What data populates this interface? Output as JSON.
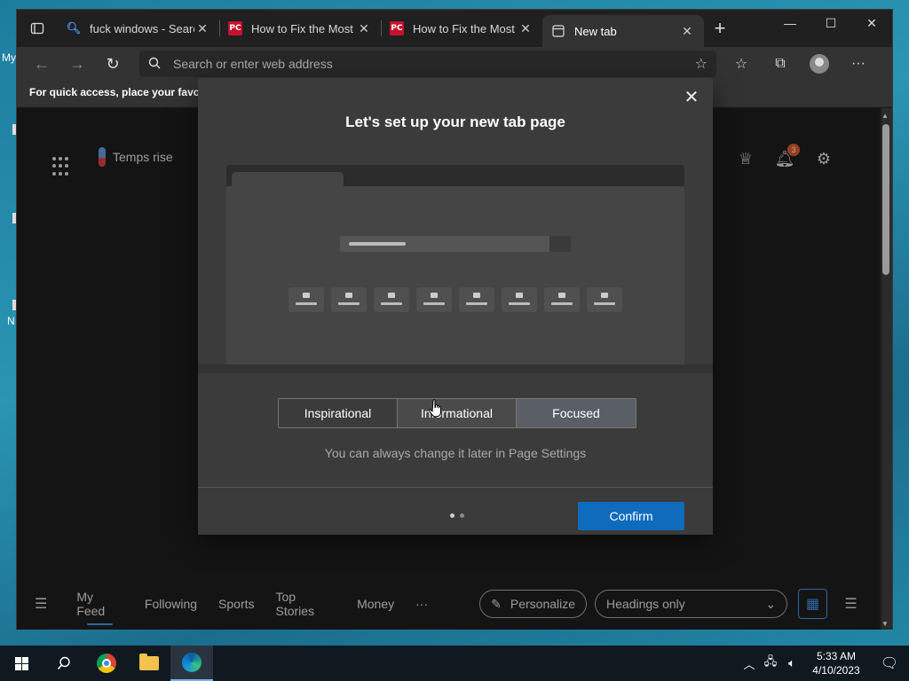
{
  "desktop": {
    "label_top": "My",
    "label_bottom": "N"
  },
  "browser": {
    "tabs": [
      {
        "title": "fuck windows - Search",
        "favicon": "search-icon"
      },
      {
        "title": "How to Fix the Most Annoying",
        "favicon": "pc-icon"
      },
      {
        "title": "How to Fix the Most Annoying",
        "favicon": "pc-icon"
      },
      {
        "title": "New tab",
        "favicon": "newtab-icon",
        "active": true
      }
    ],
    "favicon_pc_text": "PC",
    "address_placeholder": "Search or enter web address",
    "favorites_bar_text": "For quick access, place your favorites here"
  },
  "ntp": {
    "weather_text": "Temps rise",
    "notification_count": "3",
    "feed_tabs": [
      "My Feed",
      "Following",
      "Sports",
      "Top Stories",
      "Money"
    ],
    "more": "···",
    "personalize_label": "Personalize",
    "headings_label": "Headings only"
  },
  "modal": {
    "title": "Let's set up your new tab page",
    "options": [
      "Inspirational",
      "Informational",
      "Focused"
    ],
    "selected_option": "Focused",
    "hint": "You can always change it later in Page Settings",
    "confirm_label": "Confirm"
  },
  "taskbar": {
    "time": "5:33 AM",
    "date": "4/10/2023"
  },
  "colors": {
    "accent": "#0f6cbd",
    "link_blue": "#4a9eff",
    "badge": "#e8632b"
  }
}
